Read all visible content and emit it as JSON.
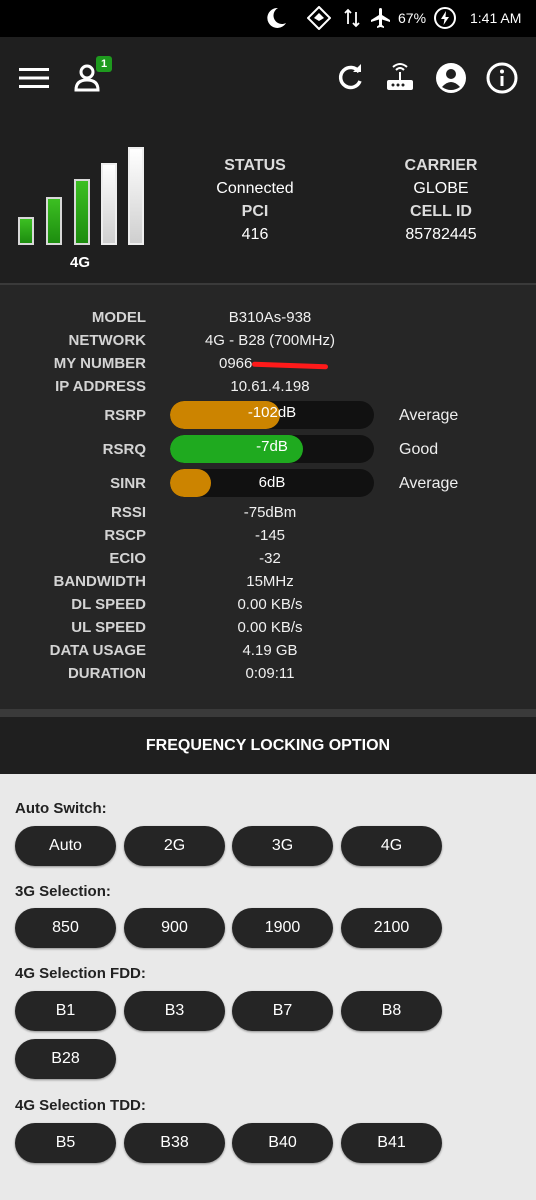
{
  "statusbar": {
    "battery_pct": "67%",
    "time": "1:41 AM"
  },
  "header": {
    "notification_count": "1",
    "network_type": "4G",
    "status_label": "STATUS",
    "status_value": "Connected",
    "carrier_label": "CARRIER",
    "carrier_value": "GLOBE",
    "pci_label": "PCI",
    "pci_value": "416",
    "cellid_label": "CELL ID",
    "cellid_value": "85782445",
    "signal_bars_active": 3,
    "signal_bars_total": 5
  },
  "details": {
    "model_label": "MODEL",
    "model": "B310As-938",
    "network_label": "NETWORK",
    "network": "4G - B28 (700MHz)",
    "mynumber_label": "MY NUMBER",
    "mynumber": "0966",
    "ip_label": "IP ADDRESS",
    "ip": "10.61.4.198",
    "rsrp_label": "RSRP",
    "rsrp": "-102dB",
    "rsrp_quality": "Average",
    "rsrp_level": 0.54,
    "rsrq_label": "RSRQ",
    "rsrq": "-7dB",
    "rsrq_quality": "Good",
    "rsrq_level": 0.65,
    "sinr_label": "SINR",
    "sinr": "6dB",
    "sinr_quality": "Average",
    "sinr_level": 0.2,
    "rssi_label": "RSSI",
    "rssi": "-75dBm",
    "rscp_label": "RSCP",
    "rscp": "-145",
    "ecio_label": "ECIO",
    "ecio": "-32",
    "bandwidth_label": "BANDWIDTH",
    "bandwidth": "15MHz",
    "dl_label": "DL SPEED",
    "dl": "0.00 KB/s",
    "ul_label": "UL SPEED",
    "ul": "0.00 KB/s",
    "usage_label": "DATA USAGE",
    "usage": "4.19 GB",
    "duration_label": "DURATION",
    "duration": "0:09:11"
  },
  "freq": {
    "title": "FREQUENCY LOCKING OPTION",
    "auto_label": "Auto Switch:",
    "auto": [
      "Auto",
      "2G",
      "3G",
      "4G"
    ],
    "g3_label": "3G Selection:",
    "g3": [
      "850",
      "900",
      "1900",
      "2100"
    ],
    "fdd_label": "4G Selection FDD:",
    "fdd": [
      "B1",
      "B3",
      "B7",
      "B8",
      "B28"
    ],
    "tdd_label": "4G Selection TDD:",
    "tdd": [
      "B5",
      "B38",
      "B40",
      "B41"
    ]
  },
  "colors": {
    "average": "#cc8400",
    "good": "#1faa1f",
    "panel": "#1f1f1f",
    "details": "#262626"
  },
  "icons": [
    "moon-icon",
    "data-saver-icon",
    "data-arrows-icon",
    "airplane-icon",
    "battery-saver-icon",
    "menu-icon",
    "user-icon",
    "refresh-icon",
    "router-icon",
    "account-icon",
    "info-icon"
  ]
}
